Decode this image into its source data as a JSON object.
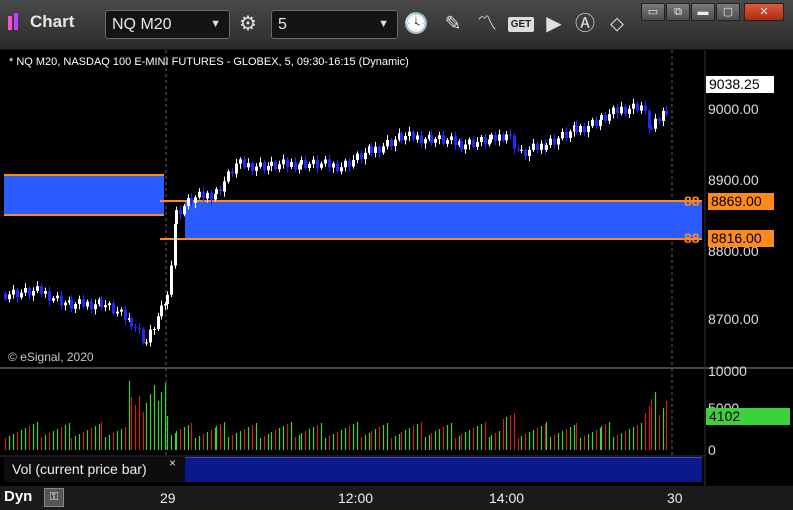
{
  "window": {
    "title": "Chart",
    "symbol": "NQ M20",
    "interval": "5",
    "buttons": [
      "minimize",
      "restore",
      "maximize",
      "close"
    ]
  },
  "toolbar": {
    "icons": [
      "link-settings-icon",
      "clock-icon",
      "pencil-icon",
      "study-icon",
      "get-icon",
      "play-icon",
      "alert-icon",
      "tag-icon"
    ],
    "get_label": "GET"
  },
  "chart": {
    "legend": "* NQ M20, NASDAQ 100 E-MINI FUTURES - GLOBEX, 5, 09:30-16:15 (Dynamic)",
    "copyright": "© eSignal, 2020",
    "last_price": "9038.25",
    "price_axis": [
      "9000.00",
      "8900.00",
      "8800.00",
      "8700.00"
    ],
    "zone_levels": [
      {
        "tag": "88",
        "price": "8869.00"
      },
      {
        "tag": "88",
        "price": "8816.00"
      }
    ],
    "colors": {
      "up": "#ffffff",
      "down": "#1e28ff",
      "zone": "#2b5cff",
      "zone_line": "#ff8a1a",
      "vol_up": "#3cd23c",
      "vol_down": "#d21e1e"
    }
  },
  "volume": {
    "label": "Vol (current price bar)",
    "close_symbol": "×",
    "axis": [
      "10000",
      "5000",
      "0"
    ],
    "current": "4102"
  },
  "time_axis": [
    "29",
    "12:00",
    "14:00",
    "30"
  ],
  "footer": {
    "mode": "Dyn",
    "lock_label": "🔒"
  }
}
